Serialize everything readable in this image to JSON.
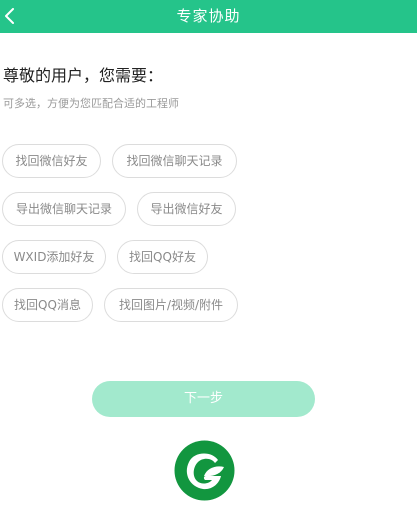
{
  "header": {
    "title": "专家协助"
  },
  "greeting": "尊敬的用户，您需要：",
  "hint": "可多选，方便为您匹配合适的工程师",
  "options": [
    "找回微信好友",
    "找回微信聊天记录",
    "导出微信聊天记录",
    "导出微信好友",
    "WXID添加好友",
    "找回QQ好友",
    "找回QQ消息",
    "找回图片/视频/附件"
  ],
  "next_button": "下一步",
  "colors": {
    "brand_green": "#25c48a",
    "button_disabled": "#a2e9cd",
    "logo_green": "#12963f"
  },
  "icons": {
    "back": "chevron-left-icon",
    "logo": "app-logo"
  }
}
